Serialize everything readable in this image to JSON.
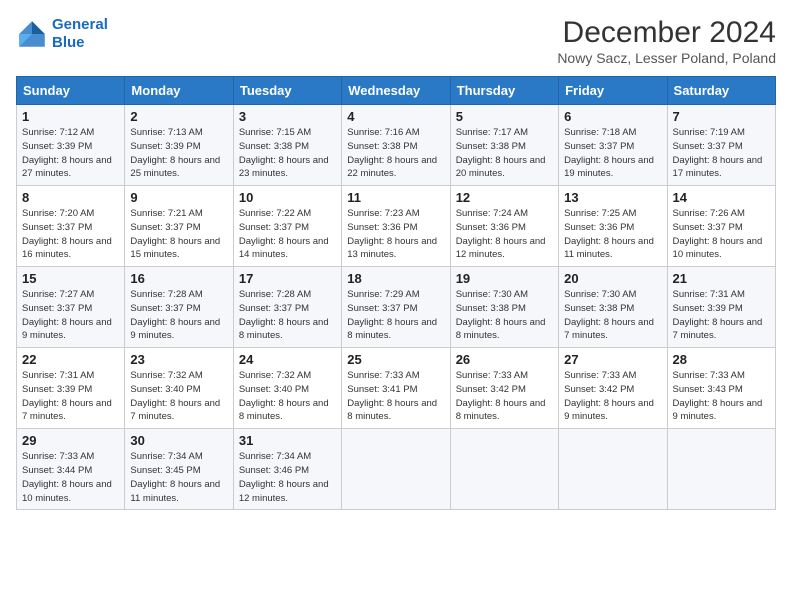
{
  "logo": {
    "line1": "General",
    "line2": "Blue"
  },
  "title": "December 2024",
  "subtitle": "Nowy Sacz, Lesser Poland, Poland",
  "headers": [
    "Sunday",
    "Monday",
    "Tuesday",
    "Wednesday",
    "Thursday",
    "Friday",
    "Saturday"
  ],
  "weeks": [
    [
      {
        "day": "1",
        "sunrise": "Sunrise: 7:12 AM",
        "sunset": "Sunset: 3:39 PM",
        "daylight": "Daylight: 8 hours and 27 minutes."
      },
      {
        "day": "2",
        "sunrise": "Sunrise: 7:13 AM",
        "sunset": "Sunset: 3:39 PM",
        "daylight": "Daylight: 8 hours and 25 minutes."
      },
      {
        "day": "3",
        "sunrise": "Sunrise: 7:15 AM",
        "sunset": "Sunset: 3:38 PM",
        "daylight": "Daylight: 8 hours and 23 minutes."
      },
      {
        "day": "4",
        "sunrise": "Sunrise: 7:16 AM",
        "sunset": "Sunset: 3:38 PM",
        "daylight": "Daylight: 8 hours and 22 minutes."
      },
      {
        "day": "5",
        "sunrise": "Sunrise: 7:17 AM",
        "sunset": "Sunset: 3:38 PM",
        "daylight": "Daylight: 8 hours and 20 minutes."
      },
      {
        "day": "6",
        "sunrise": "Sunrise: 7:18 AM",
        "sunset": "Sunset: 3:37 PM",
        "daylight": "Daylight: 8 hours and 19 minutes."
      },
      {
        "day": "7",
        "sunrise": "Sunrise: 7:19 AM",
        "sunset": "Sunset: 3:37 PM",
        "daylight": "Daylight: 8 hours and 17 minutes."
      }
    ],
    [
      {
        "day": "8",
        "sunrise": "Sunrise: 7:20 AM",
        "sunset": "Sunset: 3:37 PM",
        "daylight": "Daylight: 8 hours and 16 minutes."
      },
      {
        "day": "9",
        "sunrise": "Sunrise: 7:21 AM",
        "sunset": "Sunset: 3:37 PM",
        "daylight": "Daylight: 8 hours and 15 minutes."
      },
      {
        "day": "10",
        "sunrise": "Sunrise: 7:22 AM",
        "sunset": "Sunset: 3:37 PM",
        "daylight": "Daylight: 8 hours and 14 minutes."
      },
      {
        "day": "11",
        "sunrise": "Sunrise: 7:23 AM",
        "sunset": "Sunset: 3:36 PM",
        "daylight": "Daylight: 8 hours and 13 minutes."
      },
      {
        "day": "12",
        "sunrise": "Sunrise: 7:24 AM",
        "sunset": "Sunset: 3:36 PM",
        "daylight": "Daylight: 8 hours and 12 minutes."
      },
      {
        "day": "13",
        "sunrise": "Sunrise: 7:25 AM",
        "sunset": "Sunset: 3:36 PM",
        "daylight": "Daylight: 8 hours and 11 minutes."
      },
      {
        "day": "14",
        "sunrise": "Sunrise: 7:26 AM",
        "sunset": "Sunset: 3:37 PM",
        "daylight": "Daylight: 8 hours and 10 minutes."
      }
    ],
    [
      {
        "day": "15",
        "sunrise": "Sunrise: 7:27 AM",
        "sunset": "Sunset: 3:37 PM",
        "daylight": "Daylight: 8 hours and 9 minutes."
      },
      {
        "day": "16",
        "sunrise": "Sunrise: 7:28 AM",
        "sunset": "Sunset: 3:37 PM",
        "daylight": "Daylight: 8 hours and 9 minutes."
      },
      {
        "day": "17",
        "sunrise": "Sunrise: 7:28 AM",
        "sunset": "Sunset: 3:37 PM",
        "daylight": "Daylight: 8 hours and 8 minutes."
      },
      {
        "day": "18",
        "sunrise": "Sunrise: 7:29 AM",
        "sunset": "Sunset: 3:37 PM",
        "daylight": "Daylight: 8 hours and 8 minutes."
      },
      {
        "day": "19",
        "sunrise": "Sunrise: 7:30 AM",
        "sunset": "Sunset: 3:38 PM",
        "daylight": "Daylight: 8 hours and 8 minutes."
      },
      {
        "day": "20",
        "sunrise": "Sunrise: 7:30 AM",
        "sunset": "Sunset: 3:38 PM",
        "daylight": "Daylight: 8 hours and 7 minutes."
      },
      {
        "day": "21",
        "sunrise": "Sunrise: 7:31 AM",
        "sunset": "Sunset: 3:39 PM",
        "daylight": "Daylight: 8 hours and 7 minutes."
      }
    ],
    [
      {
        "day": "22",
        "sunrise": "Sunrise: 7:31 AM",
        "sunset": "Sunset: 3:39 PM",
        "daylight": "Daylight: 8 hours and 7 minutes."
      },
      {
        "day": "23",
        "sunrise": "Sunrise: 7:32 AM",
        "sunset": "Sunset: 3:40 PM",
        "daylight": "Daylight: 8 hours and 7 minutes."
      },
      {
        "day": "24",
        "sunrise": "Sunrise: 7:32 AM",
        "sunset": "Sunset: 3:40 PM",
        "daylight": "Daylight: 8 hours and 8 minutes."
      },
      {
        "day": "25",
        "sunrise": "Sunrise: 7:33 AM",
        "sunset": "Sunset: 3:41 PM",
        "daylight": "Daylight: 8 hours and 8 minutes."
      },
      {
        "day": "26",
        "sunrise": "Sunrise: 7:33 AM",
        "sunset": "Sunset: 3:42 PM",
        "daylight": "Daylight: 8 hours and 8 minutes."
      },
      {
        "day": "27",
        "sunrise": "Sunrise: 7:33 AM",
        "sunset": "Sunset: 3:42 PM",
        "daylight": "Daylight: 8 hours and 9 minutes."
      },
      {
        "day": "28",
        "sunrise": "Sunrise: 7:33 AM",
        "sunset": "Sunset: 3:43 PM",
        "daylight": "Daylight: 8 hours and 9 minutes."
      }
    ],
    [
      {
        "day": "29",
        "sunrise": "Sunrise: 7:33 AM",
        "sunset": "Sunset: 3:44 PM",
        "daylight": "Daylight: 8 hours and 10 minutes."
      },
      {
        "day": "30",
        "sunrise": "Sunrise: 7:34 AM",
        "sunset": "Sunset: 3:45 PM",
        "daylight": "Daylight: 8 hours and 11 minutes."
      },
      {
        "day": "31",
        "sunrise": "Sunrise: 7:34 AM",
        "sunset": "Sunset: 3:46 PM",
        "daylight": "Daylight: 8 hours and 12 minutes."
      },
      null,
      null,
      null,
      null
    ]
  ]
}
